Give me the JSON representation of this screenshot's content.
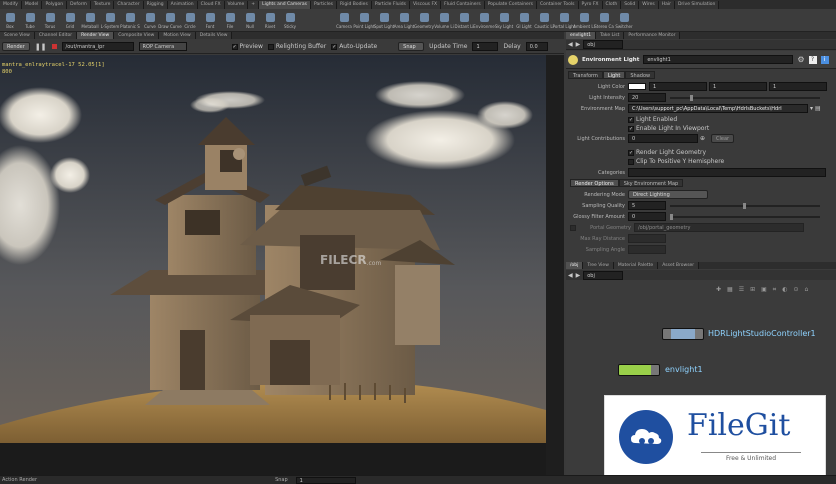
{
  "shelf_tabs": [
    "Modify",
    "Model",
    "Polygon",
    "Deform",
    "Texture",
    "Character",
    "Rigging",
    "Animation",
    "Cloud FX",
    "Volume",
    "+",
    "Lights and Cameras",
    "Particles",
    "Rigid Bodies",
    "Particle Fluids",
    "Viscous FX",
    "Fluid Containers",
    "Populate Containers",
    "Container Tools",
    "Pyro FX",
    "Cloth",
    "Solid",
    "Wires",
    "Hair",
    "Drive Simulation"
  ],
  "shelf_active": 11,
  "left_tools": [
    "Box",
    "Tube",
    "Torus",
    "Grid",
    "Metaball",
    "L-System",
    "Platonic S",
    "Curve",
    "Draw Curve",
    "Circle",
    "Font",
    "File",
    "Null",
    "Rivet",
    "Sticky"
  ],
  "right_tools": [
    "Camera",
    "Point Light",
    "Spot Light",
    "Area Light",
    "Geometry",
    "Volume Li",
    "Distant Li",
    "Environme",
    "Sky Light",
    "GI Light",
    "Caustic Li",
    "Portal Light",
    "Ambient Li",
    "Stereo Ca",
    "Switcher"
  ],
  "left_panel_tabs": [
    "Scene View",
    "Channel Editor",
    "Render View",
    "Composite View",
    "Motion View",
    "Details View"
  ],
  "left_panel_active": 2,
  "render_bar": {
    "render_label": "Render",
    "output_path": "/out/mantra_ipr",
    "camera": "ROP Camera",
    "preview_label": "Preview",
    "reighting_label": "Relighting Buffer",
    "auto_update_label": "Auto-Update",
    "snap_label": "Snap",
    "update_time_label": "Update Time",
    "update_time_value": "1",
    "delay_label": "Delay",
    "delay_value": "0.0"
  },
  "viewport_text": {
    "line1": "mantra_enlraytracel-17 52.05[1]",
    "line2": "800"
  },
  "watermark": {
    "brand": "FILECR",
    "suffix": ".com"
  },
  "right_panel_tabs": [
    "envlight1",
    "Take List",
    "Performance Monitor"
  ],
  "right_panel_active": 0,
  "param": {
    "path": "obj",
    "node_type": "Environment Light",
    "node_name": "envlight1",
    "tabs": [
      "Transform",
      "Light",
      "Shadow"
    ],
    "active_tab": 1,
    "light_color_label": "Light Color",
    "light_color_values": [
      "1",
      "1",
      "1"
    ],
    "light_intensity_label": "Light Intensity",
    "light_intensity_value": "20",
    "env_map_label": "Environment Map",
    "env_map_value": "C:\\Users\\support_pc\\AppData\\Local\\Temp\\HdrlsBuckets\\Hdrl",
    "light_enabled_label": "Light Enabled",
    "enable_light_viewport_label": "Enable Light In Viewport",
    "light_contributions_label": "Light Contributions",
    "light_contributions_value": "0",
    "clear_label": "Clear",
    "render_geometry_label": "Render Light Geometry",
    "clip_label": "Clip To Positive Y Hemisphere",
    "categories_label": "Categories",
    "sub_tabs": [
      "Render Options",
      "Sky Environment Map"
    ],
    "sub_active": 0,
    "rendering_mode_label": "Rendering Mode",
    "rendering_mode_value": "Direct Lighting",
    "sampling_quality_label": "Sampling Quality",
    "sampling_quality_value": "5",
    "glossy_filter_label": "Glossy Filter Amount",
    "glossy_filter_value": "0",
    "portal_geometry_label": "Portal Geometry",
    "portal_geometry_value": "/obj/portal_geometry",
    "max_ray_label": "Max Ray Distance",
    "sampling_angle_label": "Sampling Angle"
  },
  "network_tabs": [
    "/obj",
    "Tree View",
    "Material Palette",
    "Asset Browser"
  ],
  "network_active": 0,
  "network_path": "obj",
  "nodes": [
    {
      "name": "HDRLightStudioController1",
      "color": "#8aa9c9"
    },
    {
      "name": "envlight1",
      "color": "#9ad04a"
    }
  ],
  "status": {
    "left": "Action Render",
    "snap_label": "Snap",
    "snap_value": "1"
  },
  "badge": {
    "title": "FileGit",
    "tagline": "Free & Unlimited"
  },
  "colors": {
    "accent": "#e6d36a",
    "node_label": "#8fd3ff",
    "filegit_blue": "#1f4fa0"
  }
}
